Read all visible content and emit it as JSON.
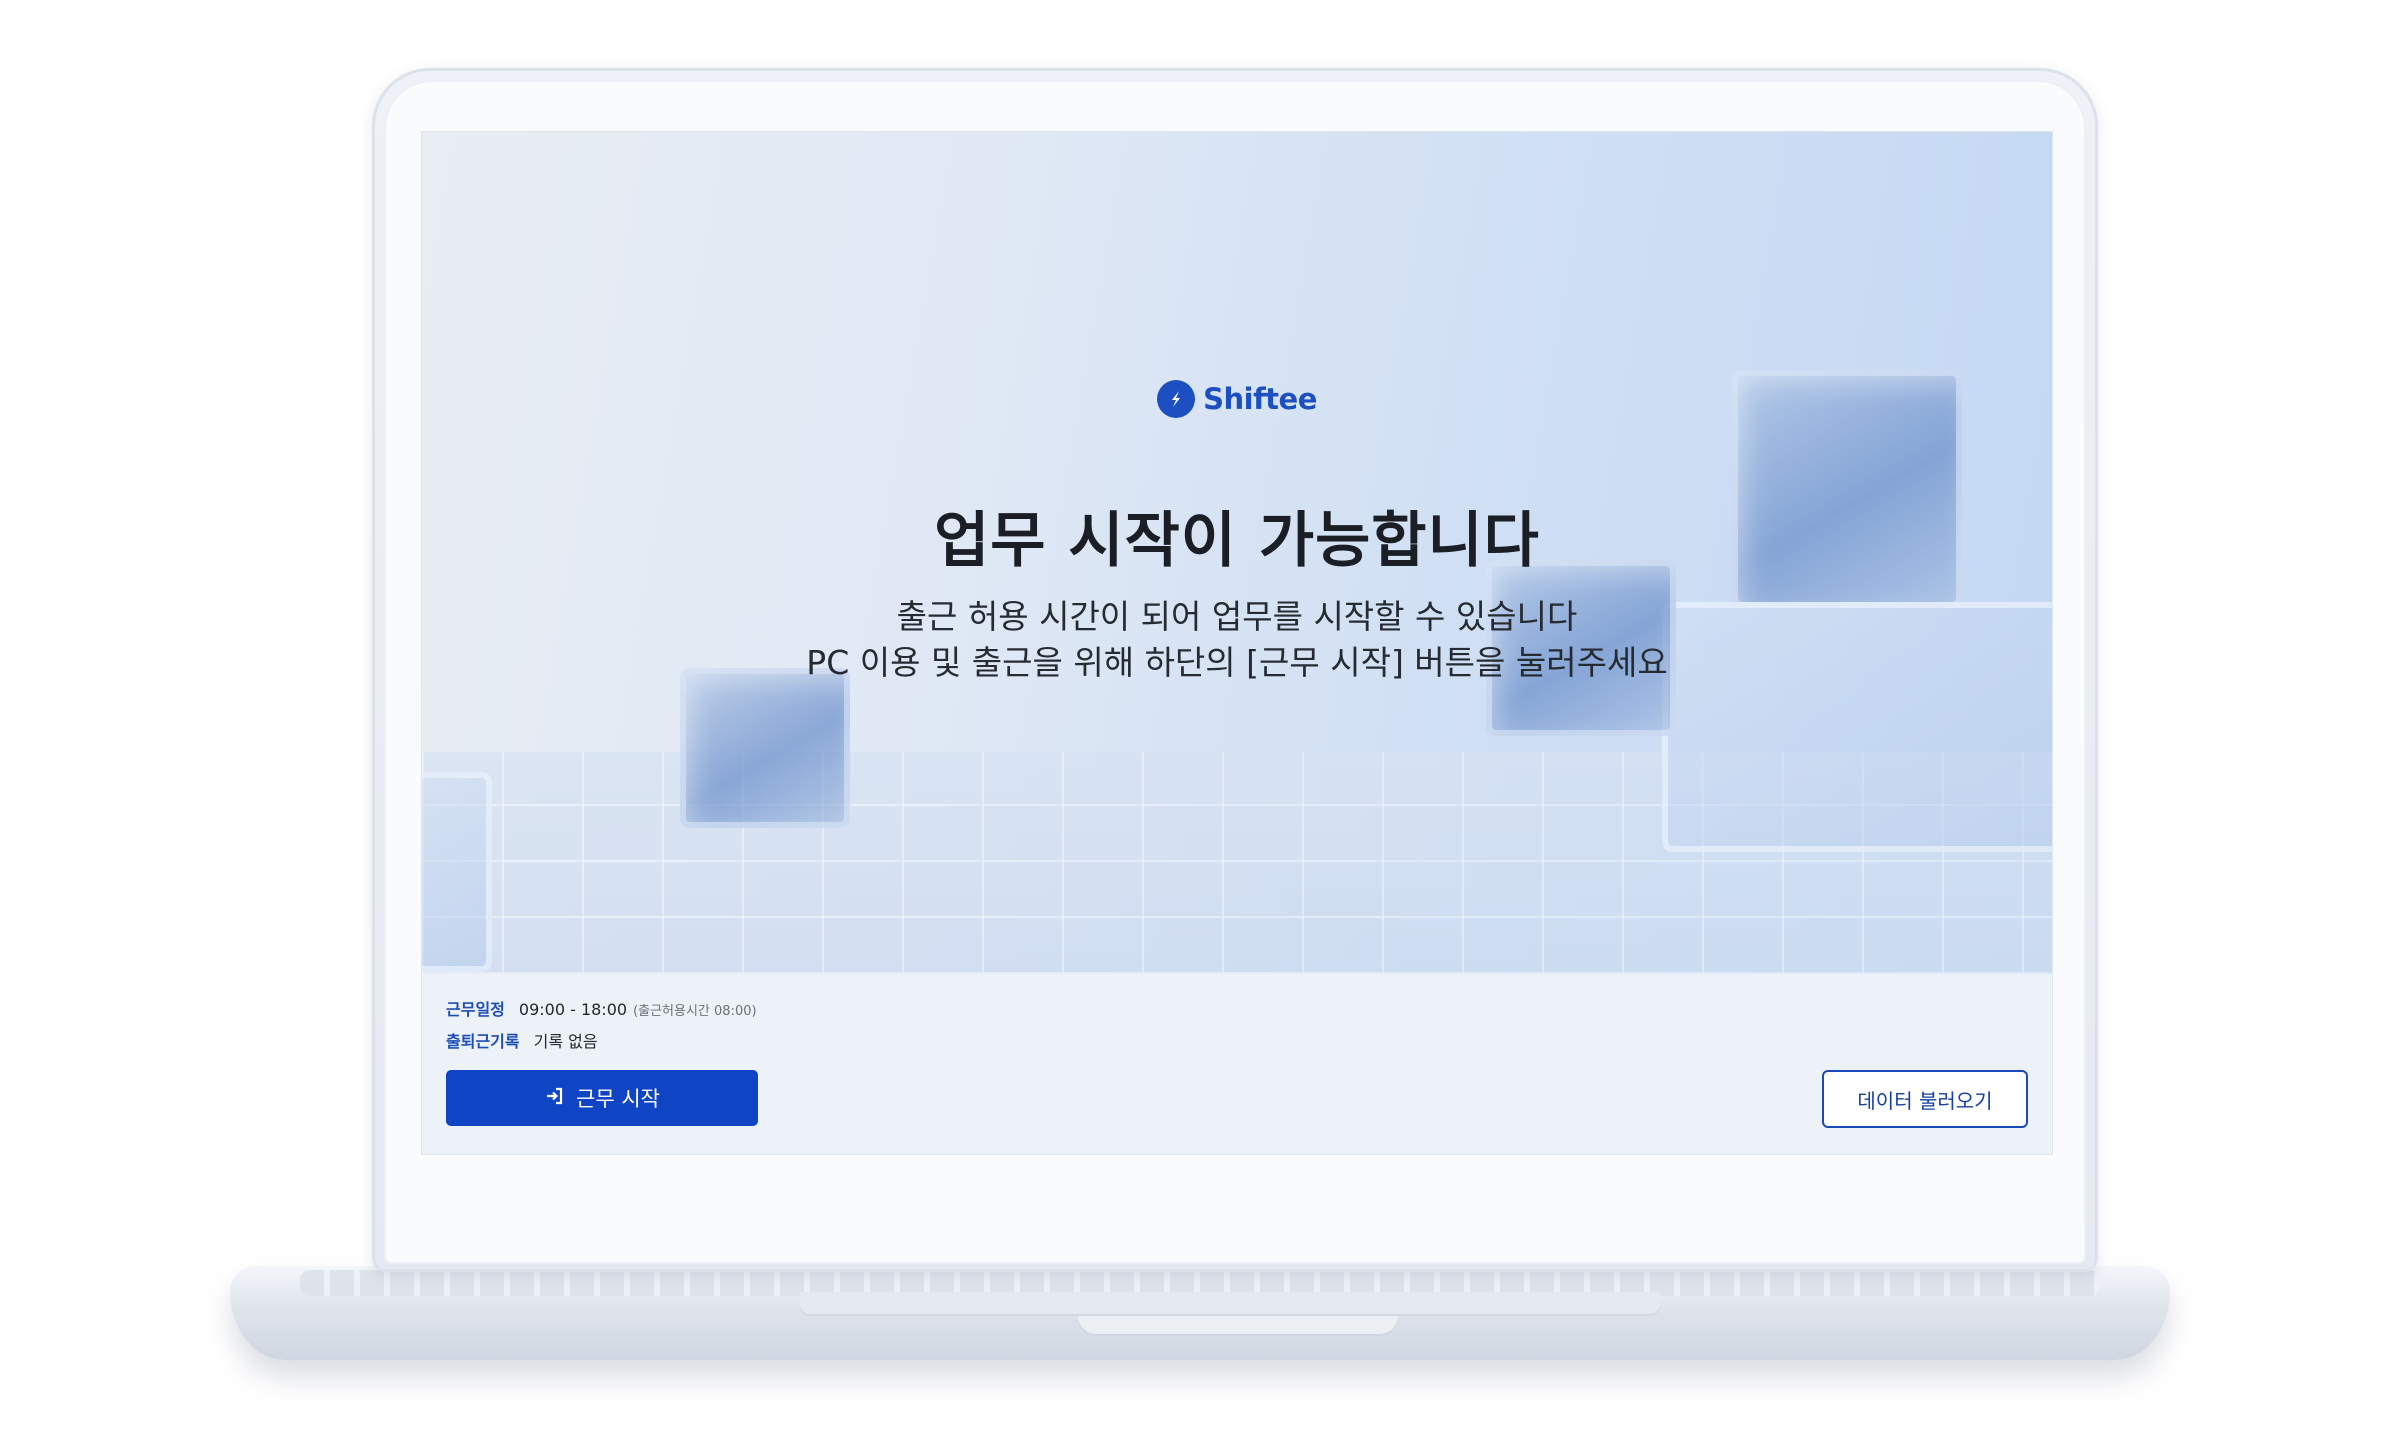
{
  "app": {
    "brand_name": "Shiftee",
    "brand_color": "#1c4fc1"
  },
  "hero": {
    "headline": "업무 시작이 가능합니다",
    "line1": "출근 허용 시간이 되어 업무를 시작할 수 있습니다",
    "line2": "PC 이용 및 출근을 위해 하단의 [근무 시작] 버튼을 눌러주세요"
  },
  "info": {
    "schedule_label": "근무일정",
    "schedule_value": "09:00 - 18:00",
    "schedule_note": "(출근허용시간  08:00)",
    "record_label": "출퇴근기록",
    "record_value": "기록 없음"
  },
  "actions": {
    "start_label": "근무 시작",
    "start_icon": "login-arrow-icon",
    "load_label": "데이터 불러오기"
  },
  "colors": {
    "primary": "#0f45c4",
    "label_blue": "#1d4eb8"
  }
}
